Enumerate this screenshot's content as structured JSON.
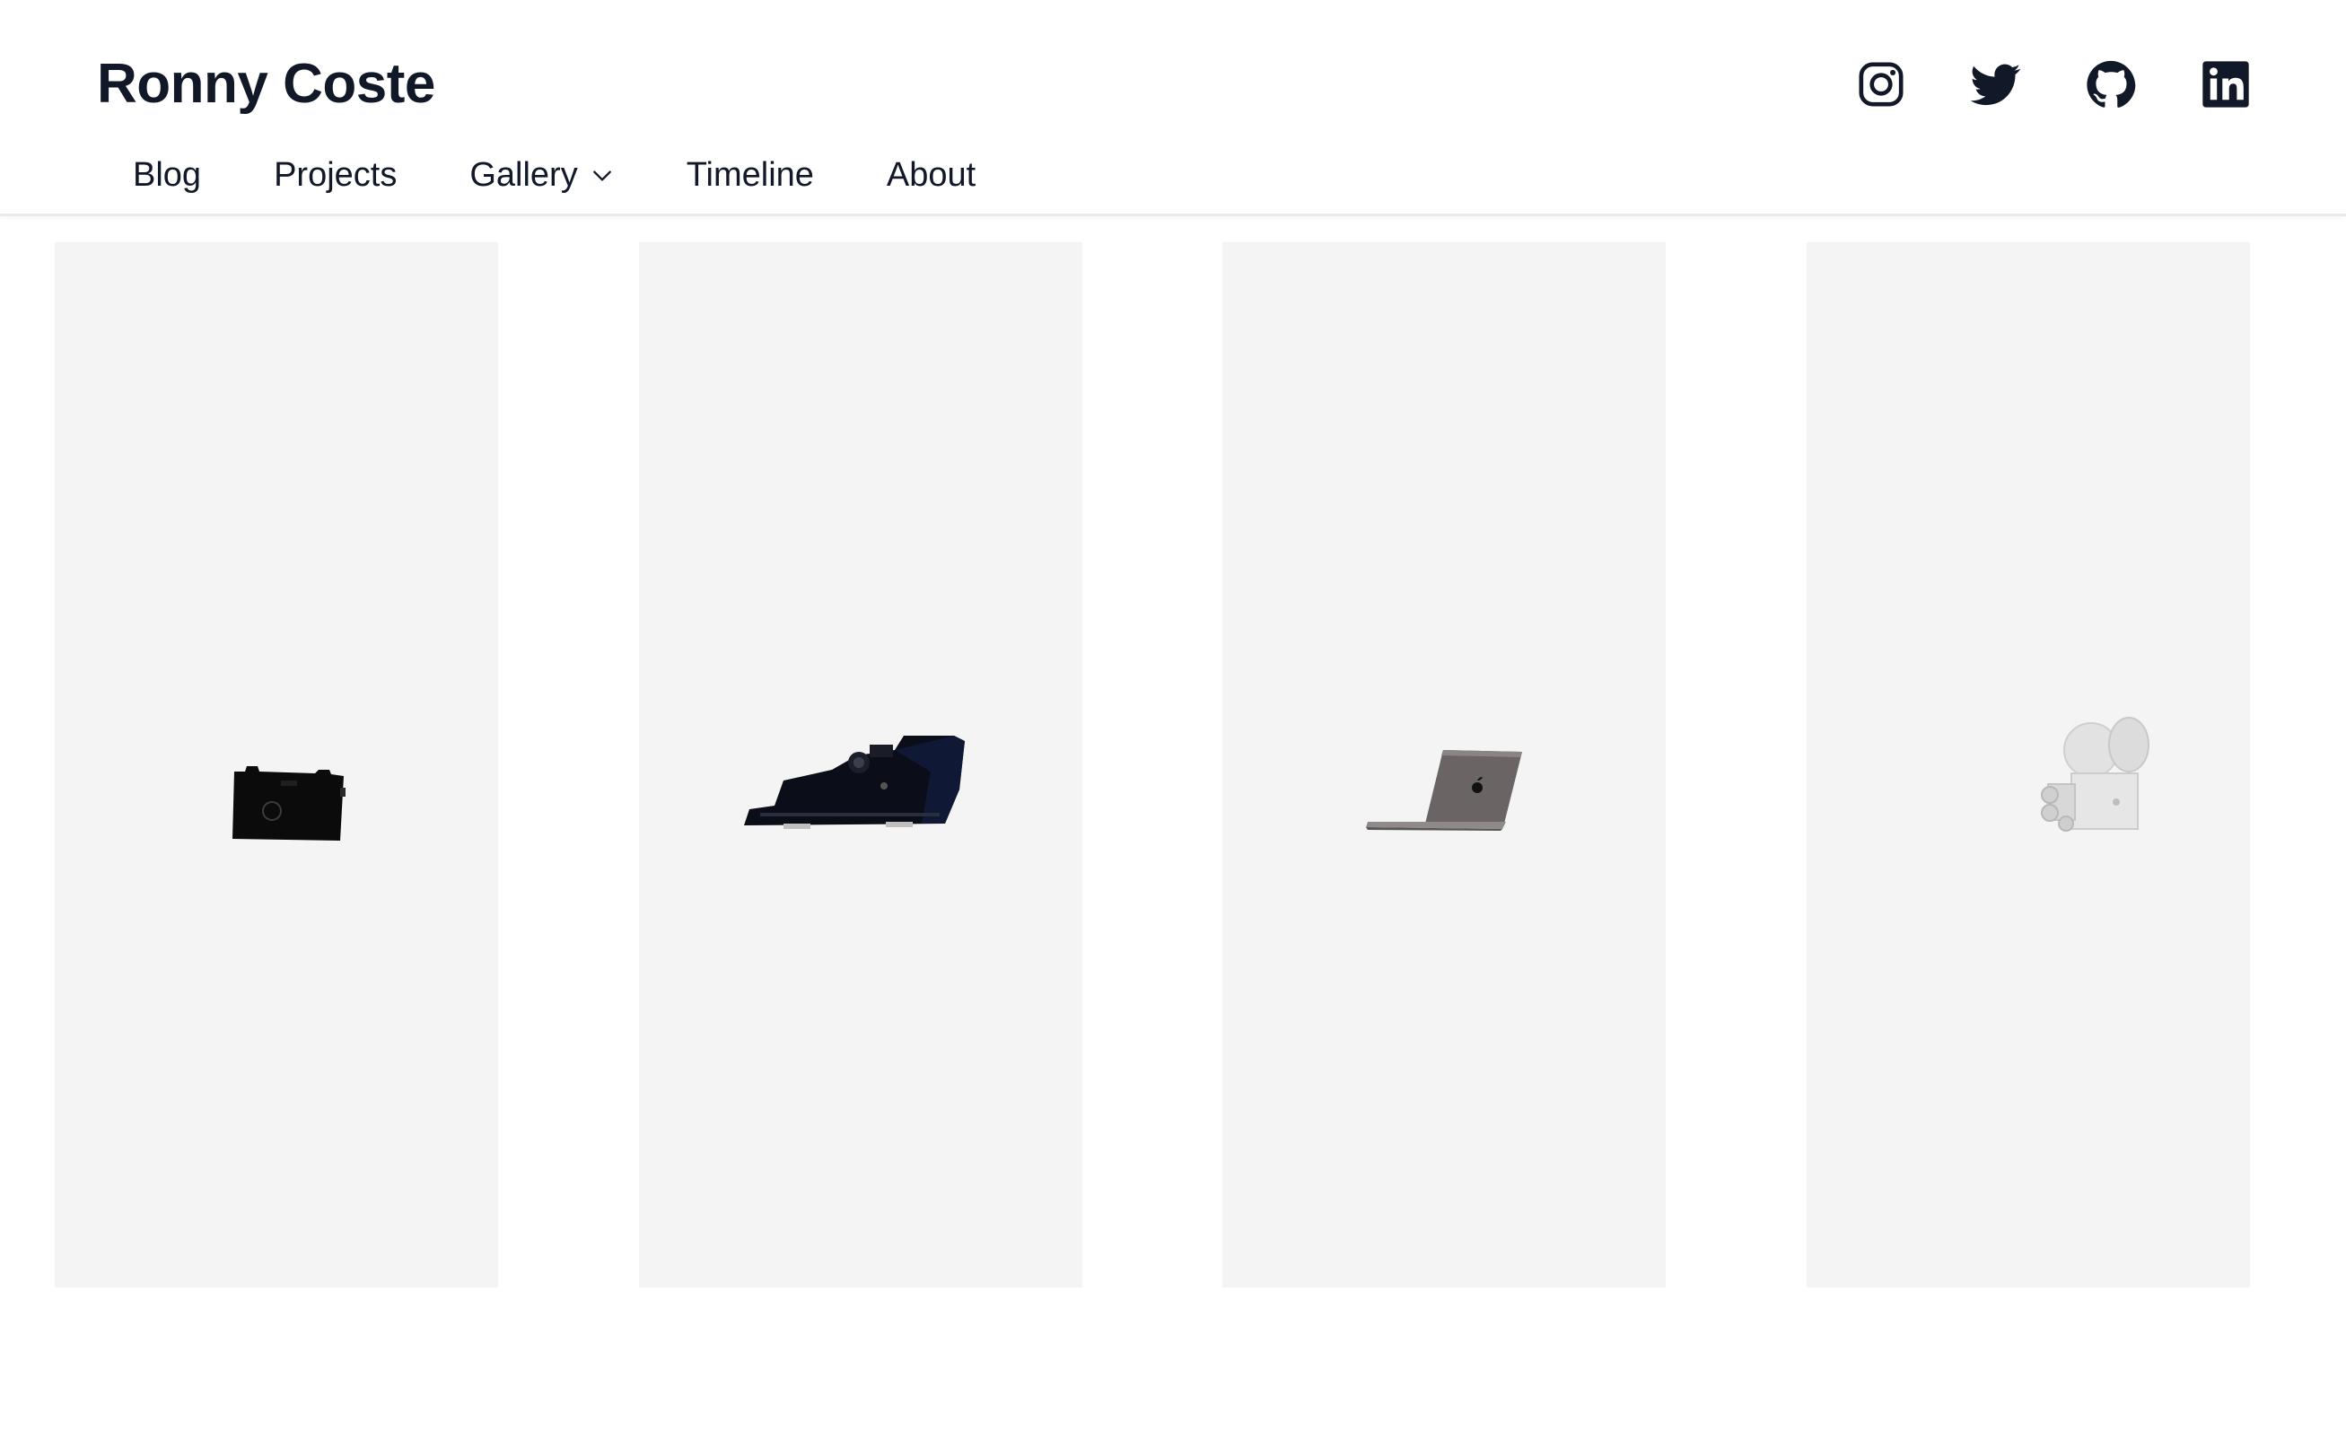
{
  "site": {
    "title": "Ronny Coste"
  },
  "nav": {
    "items": [
      {
        "label": "Blog",
        "has_dropdown": false
      },
      {
        "label": "Projects",
        "has_dropdown": false
      },
      {
        "label": "Gallery",
        "has_dropdown": true
      },
      {
        "label": "Timeline",
        "has_dropdown": false
      },
      {
        "label": "About",
        "has_dropdown": false
      }
    ]
  },
  "social": {
    "icons": [
      "instagram-icon",
      "twitter-icon",
      "github-icon",
      "linkedin-icon"
    ]
  },
  "gallery": {
    "cards": [
      {
        "icon": "film-camera-icon"
      },
      {
        "icon": "typewriter-icon"
      },
      {
        "icon": "laptop-icon"
      },
      {
        "icon": "movie-camera-icon"
      }
    ]
  },
  "colors": {
    "text": "#111827",
    "card_background": "#f4f4f4",
    "header_border": "#e8e9eb"
  }
}
